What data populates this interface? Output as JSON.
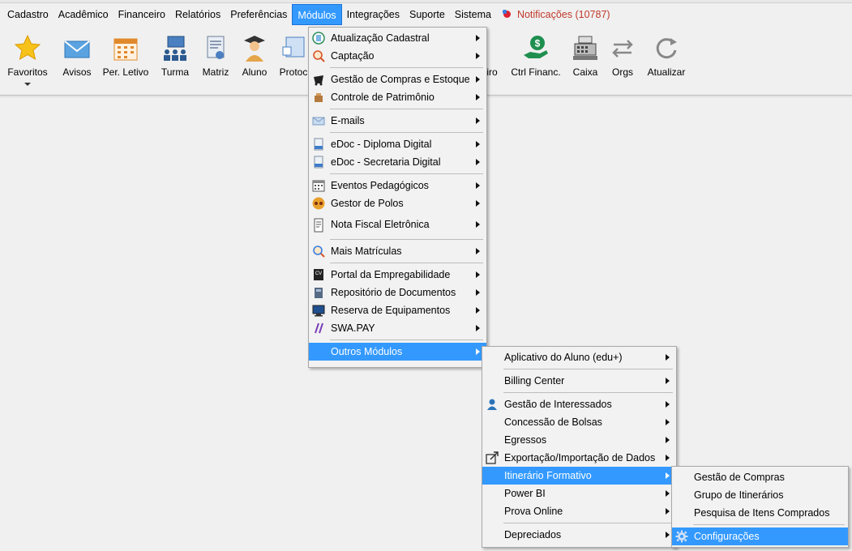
{
  "menubar": {
    "items": [
      "Cadastro",
      "Acadêmico",
      "Financeiro",
      "Relatórios",
      "Preferências",
      "Módulos",
      "Integrações",
      "Suporte",
      "Sistema"
    ],
    "notifications": "Notificações (10787)"
  },
  "toolbar": {
    "favoritos": "Favoritos",
    "avisos": "Avisos",
    "per_letivo": "Per. Letivo",
    "turma": "Turma",
    "matriz": "Matriz",
    "aluno": "Aluno",
    "protoc": "Protoc",
    "iro": "iro",
    "ctrl_financ": "Ctrl Financ.",
    "caixa": "Caixa",
    "orgs": "Orgs",
    "atualizar": "Atualizar"
  },
  "modulos_menu": {
    "atualizacao_cadastral": "Atualização Cadastral",
    "captacao": "Captação",
    "gestao_compras_estoque": "Gestão de Compras e Estoque",
    "controle_patrimonio": "Controle de Patrimônio",
    "emails": "E-mails",
    "edoc_diploma": "eDoc - Diploma Digital",
    "edoc_secretaria": "eDoc - Secretaria Digital",
    "eventos_pedagogicos": "Eventos Pedagógicos",
    "gestor_polos": "Gestor de Polos",
    "nota_fiscal": "Nota Fiscal Eletrônica",
    "mais_matriculas": "Mais Matrículas",
    "portal_empregabilidade": "Portal da Empregabilidade",
    "repositorio_documentos": "Repositório de Documentos",
    "reserva_equipamentos": "Reserva de Equipamentos",
    "swa_pay": "SWA.PAY",
    "outros_modulos": "Outros Módulos"
  },
  "outros_menu": {
    "app_aluno": "Aplicativo do Aluno (edu+)",
    "billing_center": "Billing Center",
    "gestao_interessados": "Gestão de Interessados",
    "concessao_bolsas": "Concessão de Bolsas",
    "egressos": "Egressos",
    "exportacao_importacao": "Exportação/Importação de Dados",
    "itinerario_formativo": "Itinerário Formativo",
    "power_bi": "Power BI",
    "prova_online": "Prova Online",
    "depreciados": "Depreciados"
  },
  "itinerario_menu": {
    "gestao_compras": "Gestão de Compras",
    "grupo_itinerarios": "Grupo de Itinerários",
    "pesquisa_itens": "Pesquisa de Itens Comprados",
    "configuracoes": "Configurações"
  }
}
